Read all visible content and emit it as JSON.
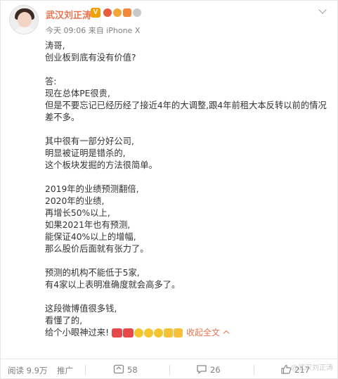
{
  "post": {
    "username": "武汉刘正涛",
    "meta": "今天 09:06 来自 iPhone X",
    "lines": [
      "涛哥,",
      "创业板到底有没有价值?",
      "",
      "答:",
      "现在总体PE很贵,",
      "但是不要忘记已经历经了接近4年的大调整,跟4年前租大本反转以前的情况",
      "差不多。",
      "",
      "其中很有一部分好公司,",
      "明显被证明是错杀的,",
      "这个板块发掘的方法很简单。",
      "",
      "2019年的业绩预测翻倍,",
      "2020年的业绩,",
      "再增长50%以上,",
      "如果2021年也有预测,",
      "能保证40%以上的增幅,",
      "那么股价后面就有张力了。",
      "",
      "预测的机构不能低于5家,",
      "有4家以上表明准确度就会高多了。",
      "",
      "这段微博值很多钱,",
      "看懂了的,"
    ],
    "last_line": "给个小眼神过来!",
    "expand_label": "收起全文"
  },
  "footer": {
    "reads": "阅读 9.9万",
    "promote": "推广",
    "reposts": "58",
    "comments": "26",
    "likes": "217"
  },
  "watermark": "@武汉刘正涛",
  "icons": {
    "verified": "v-badge-icon",
    "more": "chevron-down-icon",
    "repost": "repost-icon",
    "comment": "comment-icon",
    "like": "like-icon"
  },
  "colors": {
    "username": "#eb7350",
    "expand": "#eb7350",
    "meta": "#808080"
  }
}
